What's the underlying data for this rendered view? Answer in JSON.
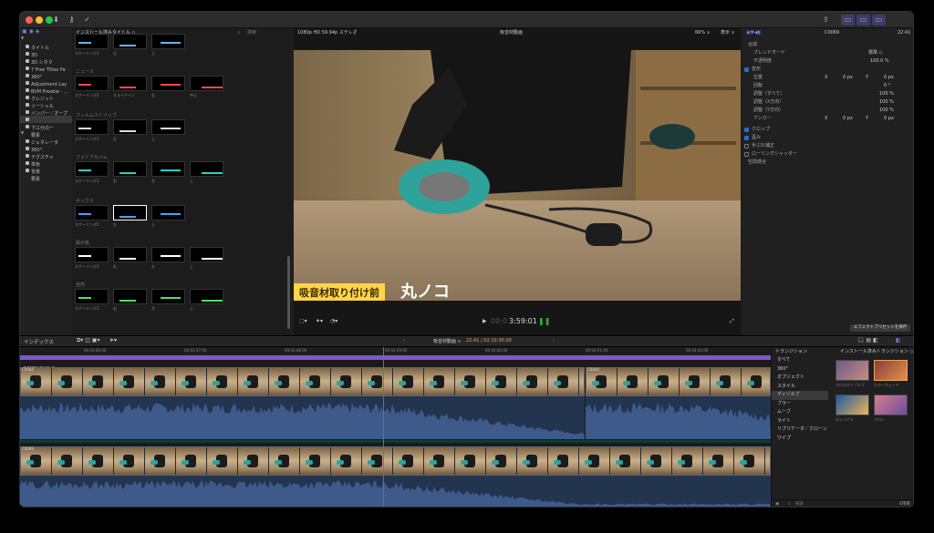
{
  "toolbar": {
    "buttons": [
      "download-icon",
      "key-icon",
      "check-icon"
    ],
    "right_buttons": [
      "share-icon",
      "layout-1",
      "layout-2",
      "layout-3"
    ]
  },
  "sidebar": {
    "items": [
      {
        "label": "タイトル",
        "disclosure": "▼"
      },
      {
        "label": "3D"
      },
      {
        "label": "3D シネマ"
      },
      {
        "label": "7 Free Titles Pa"
      },
      {
        "label": "360°"
      },
      {
        "label": "Adjustment Lay"
      },
      {
        "label": "BVM Freebie - …"
      },
      {
        "label": "クレジット"
      },
      {
        "label": "ソーシャル"
      },
      {
        "label": "バンパー／オープ"
      },
      {
        "label": "ビルドイン／アウ"
      },
      {
        "label": "下三分の一",
        "selected": true
      },
      {
        "label": "要素"
      },
      {
        "label": "ジェネレータ",
        "disclosure": "▼"
      },
      {
        "label": "360°"
      },
      {
        "label": "テクスチャ"
      },
      {
        "label": "単色"
      },
      {
        "label": "背景"
      },
      {
        "label": "要素"
      }
    ]
  },
  "browser": {
    "title": "インストール済みタイトル ◇",
    "search_placeholder": "検索",
    "sections": [
      {
        "name": "",
        "labels": [
          "スケーリング2",
          "左",
          "上"
        ]
      },
      {
        "name": "ニュース",
        "labels": [
          "スケーリング2",
          "スライドイン",
          "右",
          "中心"
        ]
      },
      {
        "name": "フィルムストリップ",
        "labels": [
          "スケーリング2",
          "左",
          "上"
        ]
      },
      {
        "name": "フォトアルバム",
        "labels": [
          "スケーリング2",
          "右",
          "左",
          "上"
        ]
      },
      {
        "name": "ボックス",
        "labels": [
          "スケーリング2",
          "左",
          "上"
        ]
      },
      {
        "name": "開示板",
        "labels": [
          "スケーリング2",
          "右",
          "左",
          "上"
        ]
      },
      {
        "name": "自然",
        "labels": [
          "スケーリング2",
          "右",
          "左",
          "上"
        ]
      }
    ]
  },
  "viewer": {
    "format": "1080p HD 59.94p ステレオ",
    "clip_name": "吸音材動画",
    "zoom": "66% ∨",
    "display": "表示 ∨",
    "caption_left": "吸音材取り付け前",
    "caption_right": "丸ノコ",
    "timecode": "3:59:01",
    "timecode_prefix": "00:0"
  },
  "inspector": {
    "clip": "C0069",
    "time": "22:41",
    "sections": {
      "composite": "合成",
      "blend_mode": "ブレンドモード",
      "blend_value": "標準 ◇",
      "opacity": "不透明度",
      "opacity_value": "100.0 %",
      "transform": "変形",
      "position": "位置",
      "rotation": "回転",
      "scale_all": "調整（すべて）",
      "scale_x": "調整（X方向）",
      "scale_y": "調整（Y方向）",
      "anchor": "アンカー",
      "crop": "クロップ",
      "distort": "歪み",
      "stabilize": "手ぶれ補正",
      "rolling_shutter": "ローリングシャッター",
      "spatial": "空間適合"
    },
    "values": {
      "pos_x": "0 px",
      "pos_y": "0 px",
      "rotation": "0 °",
      "scale_all": "100 %",
      "scale_x": "100 %",
      "scale_y": "100 %",
      "anchor_x": "0 px",
      "anchor_y": "0 px",
      "x": "X",
      "y": "Y"
    }
  },
  "effects_preset_button": "エフェクトプリセットを保存",
  "timeline": {
    "index_label": "インデックス",
    "project": "吸音材動画 ∨",
    "position": "22:41 / 02:10:35:00",
    "ruler": [
      "00:03:06:00",
      "00:03:37:00",
      "00:03:48:00",
      "00:03:59:00",
      "00:04:00:00",
      "00:04:01:00",
      "00:04:02:00"
    ],
    "clips": [
      {
        "name": "C0044"
      },
      {
        "name": "C0044"
      },
      {
        "name": "C0069"
      }
    ],
    "title_bar": "吸音材取り付け前 / 丸"
  },
  "transitions": {
    "header": "トランジション",
    "browser_title": "インストール済みトランジション ◇",
    "categories": [
      {
        "label": "すべて"
      },
      {
        "label": "360°"
      },
      {
        "label": "オブジェクト"
      },
      {
        "label": "スタイル"
      },
      {
        "label": "ディゾルブ",
        "selected": true
      },
      {
        "label": "ブラー"
      },
      {
        "label": "ムーブ"
      },
      {
        "label": "ライト"
      },
      {
        "label": "リプリケータ／クローン"
      },
      {
        "label": "ワイプ"
      }
    ],
    "items": [
      "クロスディゾルブ",
      "カラーフェード",
      "ディバイド",
      "フロー"
    ],
    "count": "4項目",
    "search_placeholder": "検索"
  },
  "colors": {
    "accent": "#2a6bd1",
    "playhead": "#e0433d",
    "title_lane": "#7e58c8",
    "clip_audio": "#3d5a8a",
    "caption_yellow": "#ffd447"
  }
}
